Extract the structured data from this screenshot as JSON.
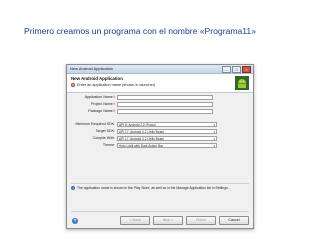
{
  "slide": {
    "title": "Primero creamos un programa con el nombre «Programa11»"
  },
  "dialog": {
    "window_title": "New Android Application",
    "header_title": "New Android Application",
    "error_message": "Enter an application name (shown in launcher)",
    "fields": [
      {
        "label": "Application Name:",
        "value": ""
      },
      {
        "label": "Project Name:",
        "value": ""
      },
      {
        "label": "Package Name:",
        "value": ""
      }
    ],
    "selects": [
      {
        "label": "Minimum Required SDK:",
        "value": "API 8: Android 2.2 (Froyo)"
      },
      {
        "label": "Target SDK:",
        "value": "API 17: Android 4.2 (Jelly Bean)"
      },
      {
        "label": "Compile With:",
        "value": "API 17: Android 4.2 (Jelly Bean)"
      },
      {
        "label": "Theme:",
        "value": "Holo Light with Dark Action Bar"
      }
    ],
    "info_message": "The application name is shown in the Play Store, as well as in the Manage Application list in Settings.",
    "buttons": {
      "back": "< Back",
      "next": "Next >",
      "finish": "Finish",
      "cancel": "Cancel"
    }
  }
}
